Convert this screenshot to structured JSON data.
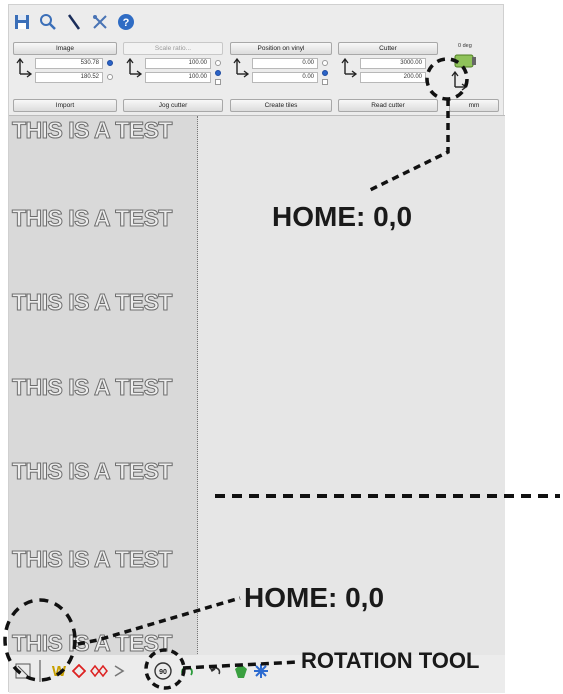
{
  "toolbar": {
    "icons": [
      "save-icon",
      "zoom-icon",
      "knife-icon",
      "tools-icon",
      "help-icon"
    ]
  },
  "panel": {
    "image_label": "Image",
    "scale_ratio_label": "Scale ratio...",
    "position_label": "Position on vinyl",
    "cutter_label": "Cutter",
    "image_w": "530.78",
    "image_h": "180.52",
    "scale_w": "100.00",
    "scale_h": "100.00",
    "pos_x": "0.00",
    "pos_y": "0.00",
    "cutter_w": "3000.00",
    "cutter_h": "200.00",
    "import_label": "Import",
    "jog_label": "Jog cutter",
    "tiles_label": "Create tiles",
    "read_label": "Read cutter",
    "degree_label": "0 deg",
    "unit_label": "mm"
  },
  "canvas": {
    "test_lines": [
      "THIS IS A TEST",
      "THIS IS A TEST",
      "THIS IS A TEST",
      "THIS IS A TEST",
      "THIS IS A TEST",
      "THIS IS A TEST",
      "THIS IS A TEST"
    ]
  },
  "statusbar": {
    "icons": [
      "select-icon",
      "weed-icon",
      "diamond-icon",
      "double-diamond-icon",
      "arrow-icon",
      "rotate-90-icon",
      "rotate-icon",
      "undo-icon",
      "gem-icon",
      "snowflake-icon"
    ],
    "rotate_label": "90"
  },
  "annotations": {
    "home_top": "HOME: 0,0",
    "home_bottom": "HOME: 0,0",
    "rotation_tool": "ROTATION TOOL"
  }
}
